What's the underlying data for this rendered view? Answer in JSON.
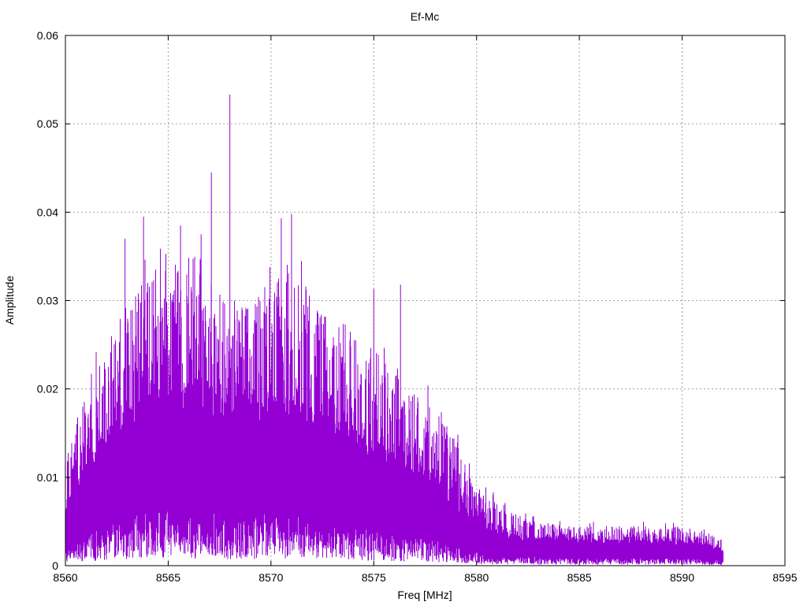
{
  "chart_data": {
    "type": "line",
    "title": "Ef-Mc",
    "xlabel": "Freq [MHz]",
    "ylabel": "Amplitude",
    "xlim": [
      8560,
      8595
    ],
    "ylim": [
      0,
      0.06
    ],
    "xticks": [
      "8560",
      "8565",
      "8570",
      "8575",
      "8580",
      "8585",
      "8590",
      "8595"
    ],
    "yticks": [
      "0",
      "0.01",
      "0.02",
      "0.03",
      "0.04",
      "0.05",
      "0.06"
    ],
    "grid": true,
    "series_color": "#9400d3",
    "series": [
      {
        "name": "Ef-Mc",
        "x_range": [
          8560,
          8592
        ],
        "envelope_x": [
          8560,
          8561,
          8562,
          8563,
          8564,
          8565,
          8566,
          8567,
          8568,
          8569,
          8570,
          8571,
          8572,
          8573,
          8574,
          8575,
          8576,
          8577,
          8578,
          8579,
          8580,
          8581,
          8582,
          8583,
          8584,
          8585,
          8586,
          8587,
          8588,
          8589,
          8590,
          8591,
          8592
        ],
        "envelope_upper": [
          0.012,
          0.02,
          0.025,
          0.03,
          0.033,
          0.034,
          0.033,
          0.031,
          0.03,
          0.03,
          0.033,
          0.034,
          0.031,
          0.028,
          0.027,
          0.024,
          0.022,
          0.02,
          0.018,
          0.014,
          0.009,
          0.0072,
          0.0058,
          0.005,
          0.0047,
          0.0046,
          0.0045,
          0.0046,
          0.0046,
          0.0045,
          0.0044,
          0.004,
          0.003
        ],
        "envelope_core": [
          0.005,
          0.009,
          0.012,
          0.014,
          0.016,
          0.016,
          0.016,
          0.015,
          0.015,
          0.015,
          0.015,
          0.015,
          0.014,
          0.013,
          0.012,
          0.011,
          0.01,
          0.009,
          0.008,
          0.006,
          0.004,
          0.003,
          0.0027,
          0.0025,
          0.0024,
          0.0024,
          0.0023,
          0.0023,
          0.0023,
          0.0023,
          0.0022,
          0.002,
          0.0015
        ],
        "peaks": [
          {
            "x": 8568.0,
            "y": 0.0533
          },
          {
            "x": 8567.1,
            "y": 0.0445
          },
          {
            "x": 8563.8,
            "y": 0.0395
          },
          {
            "x": 8571.0,
            "y": 0.0398
          },
          {
            "x": 8570.5,
            "y": 0.0393
          },
          {
            "x": 8566.6,
            "y": 0.0375
          },
          {
            "x": 8562.9,
            "y": 0.037
          },
          {
            "x": 8576.3,
            "y": 0.0318
          },
          {
            "x": 8575.0,
            "y": 0.0313
          },
          {
            "x": 8565.6,
            "y": 0.0385
          }
        ]
      }
    ]
  }
}
